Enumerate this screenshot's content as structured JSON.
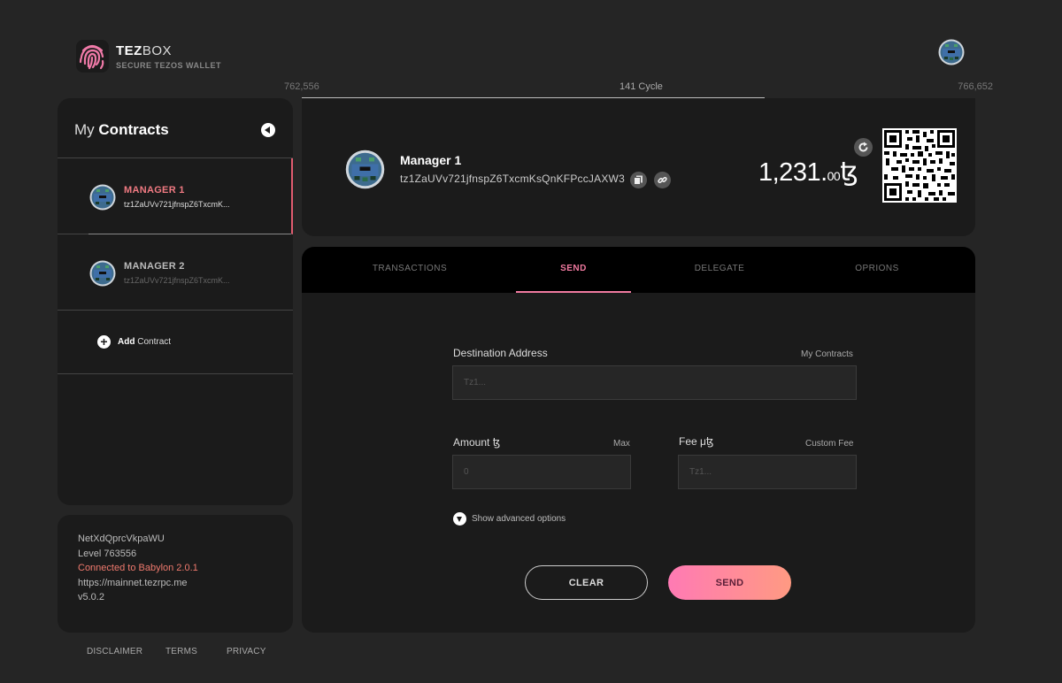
{
  "brand": {
    "name_bold": "TEZ",
    "name_light": "BOX",
    "tagline": "SECURE TEZOS WALLET"
  },
  "cycle": {
    "start": "762,556",
    "label": "141 Cycle",
    "end": "766,652",
    "progress": 0.5
  },
  "sidebar": {
    "title_light": "My",
    "title_bold": "Contracts",
    "accounts": [
      {
        "name": "MANAGER 1",
        "address": "tz1ZaUVv721jfnspZ6TxcmK...",
        "active": true
      },
      {
        "name": "MANAGER 2",
        "address": "tz1ZaUVv721jfnspZ6TxcmK...",
        "active": false
      }
    ],
    "add_bold": "Add",
    "add_light": "Contract"
  },
  "network": {
    "id": "NetXdQprcVkpaWU",
    "level": "Level 763556",
    "status": "Connected to Babylon 2.0.1",
    "rpc": "https://mainnet.tezrpc.me",
    "version": "v5.0.2",
    "status_color": "#f07a6e"
  },
  "manager": {
    "name": "Manager 1",
    "address": "tz1ZaUVv721jfnspZ6TxcmKsQnKFPccJAXW3",
    "balance_int": "1,231.",
    "balance_dec": "00",
    "balance_unit": "ꜩ"
  },
  "tabs": [
    "TRANSACTIONS",
    "SEND",
    "DELEGATE",
    "OPRIONS"
  ],
  "active_tab": "SEND",
  "form": {
    "destination_label": "Destination Address",
    "destination_link": "My Contracts",
    "destination_placeholder": "Tz1...",
    "amount_label": "Amount ꜩ",
    "amount_link": "Max",
    "amount_placeholder": "0",
    "fee_label": "Fee μꜩ",
    "fee_link": "Custom Fee",
    "fee_placeholder": "Tz1...",
    "advanced": "Show advanced options",
    "clear": "CLEAR",
    "send": "SEND"
  },
  "footer": {
    "disclaimer": "DISCLAIMER",
    "terms": "TERMS",
    "privacy": "PRIVACY"
  },
  "colors": {
    "accent": "#f07aa0",
    "background": "#252525",
    "panel": "#1b1b1b",
    "send_gradient_start": "#ff7ab4",
    "send_gradient_end": "#ff9a82"
  },
  "icons": [
    "fingerprint-logo-icon",
    "avatar-icon",
    "collapse-icon",
    "plus-icon",
    "copy-icon",
    "link-icon",
    "refresh-icon",
    "qr-code",
    "chevron-down-icon"
  ]
}
